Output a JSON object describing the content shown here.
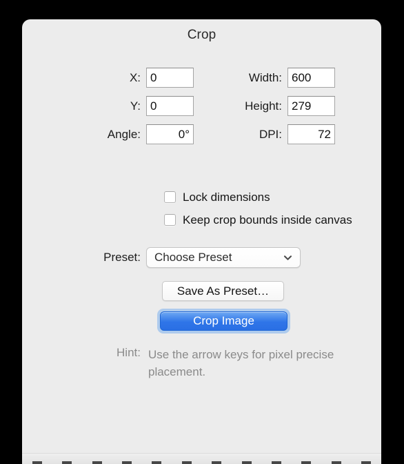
{
  "panel": {
    "title": "Crop"
  },
  "fields": [
    {
      "left": {
        "label": "X:",
        "value": "0",
        "align": "left",
        "name": "x"
      },
      "right": {
        "label": "Width:",
        "value": "600",
        "align": "left",
        "name": "width"
      }
    },
    {
      "left": {
        "label": "Y:",
        "value": "0",
        "align": "left",
        "name": "y"
      },
      "right": {
        "label": "Height:",
        "value": "279",
        "align": "left",
        "name": "height"
      }
    },
    {
      "left": {
        "label": "Angle:",
        "value": "0°",
        "align": "right",
        "name": "angle"
      },
      "right": {
        "label": "DPI:",
        "value": "72",
        "align": "right",
        "name": "dpi"
      }
    }
  ],
  "checkboxes": [
    {
      "label": "Lock dimensions",
      "checked": false
    },
    {
      "label": "Keep crop bounds inside canvas",
      "checked": false
    }
  ],
  "preset": {
    "label": "Preset:",
    "selected": "Choose Preset",
    "icon": "chevron-down-icon"
  },
  "buttons": {
    "save_preset": "Save As Preset…",
    "crop_image": "Crop Image"
  },
  "hint": {
    "label": "Hint:",
    "text": "Use the arrow keys for pixel precise placement."
  },
  "colors": {
    "panel_background": "#ececec",
    "window_background": "#000000",
    "accent_blue": "#2f75e8",
    "focus_ring": "#64a5f0",
    "hint_text": "#8a8a8a",
    "field_border": "#a4a4a4"
  }
}
